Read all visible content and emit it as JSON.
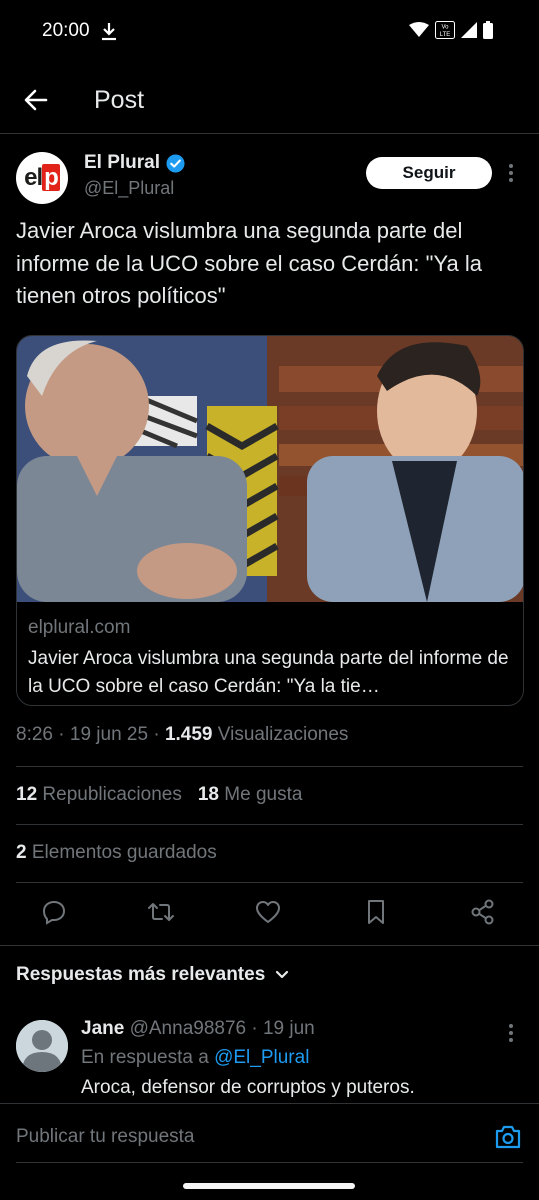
{
  "status_bar": {
    "time": "20:00",
    "volte_label": "Vo\nLTE"
  },
  "header": {
    "title": "Post"
  },
  "post": {
    "author_name": "El Plural",
    "author_handle": "@El_Plural",
    "follow_label": "Seguir",
    "avatar_logo": "elp",
    "text": "Javier Aroca vislumbra una segunda parte del informe de la UCO sobre el caso Cerdán: \"Ya la tienen otros políticos\"",
    "card": {
      "domain": "elplural.com",
      "title": "Javier Aroca vislumbra una segunda parte del informe de la UCO sobre el caso Cerdán: \"Ya la tie…"
    },
    "time": "8:26",
    "date": "19 jun 25",
    "views_count": "1.459",
    "views_label": "Visualizaciones",
    "reposts_count": "12",
    "reposts_label": "Republicaciones",
    "likes_count": "18",
    "likes_label": "Me gusta",
    "bookmarks_count": "2",
    "bookmarks_label": "Elementos guardados"
  },
  "replies": {
    "sort_label": "Respuestas más relevantes",
    "items": [
      {
        "name": "Jane",
        "handle": "@Anna98876",
        "date": "19 jun",
        "in_reply_prefix": "En respuesta a",
        "in_reply_handle": "@El_Plural",
        "text": "Aroca, defensor de corruptos y puteros."
      }
    ]
  },
  "composer": {
    "placeholder": "Publicar tu respuesta"
  },
  "colors": {
    "accent": "#1d9bf0",
    "background": "#000000",
    "text_primary": "#e7e9ea",
    "text_secondary": "#71767b",
    "border": "#2f3336"
  }
}
